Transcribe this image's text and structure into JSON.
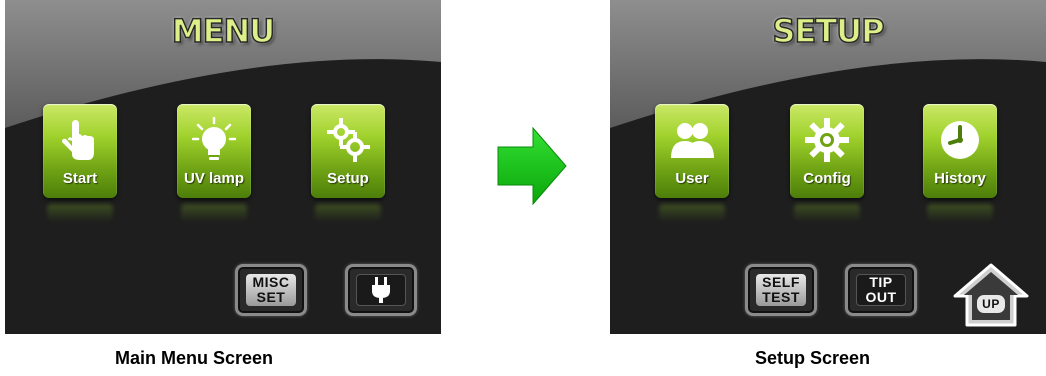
{
  "colors": {
    "tile_green": "#8bc21f",
    "title_green": "#dcef88",
    "arrow_green": "#11cc11",
    "screen_bg": "#1e1e1e"
  },
  "main_screen": {
    "title": "MENU",
    "tiles": [
      {
        "label": "Start",
        "icon": "hand-pointer-icon"
      },
      {
        "label": "UV lamp",
        "icon": "light-bulb-icon"
      },
      {
        "label": "Setup",
        "icon": "gears-icon"
      }
    ],
    "misc_button": {
      "line1": "MISC",
      "line2": "SET"
    },
    "power_button": {
      "icon": "plug-icon"
    },
    "caption": "Main Menu Screen"
  },
  "setup_screen": {
    "title": "SETUP",
    "tiles": [
      {
        "label": "User",
        "icon": "users-icon"
      },
      {
        "label": "Config",
        "icon": "gear-icon"
      },
      {
        "label": "History",
        "icon": "clock-icon"
      }
    ],
    "self_test_button": {
      "line1": "SELF",
      "line2": "TEST"
    },
    "tip_out_button": {
      "line1": "TIP",
      "line2": "OUT"
    },
    "up_button": {
      "label": "UP",
      "icon": "house-up-icon"
    },
    "caption": "Setup Screen"
  },
  "transition": {
    "icon": "right-arrow-icon"
  }
}
